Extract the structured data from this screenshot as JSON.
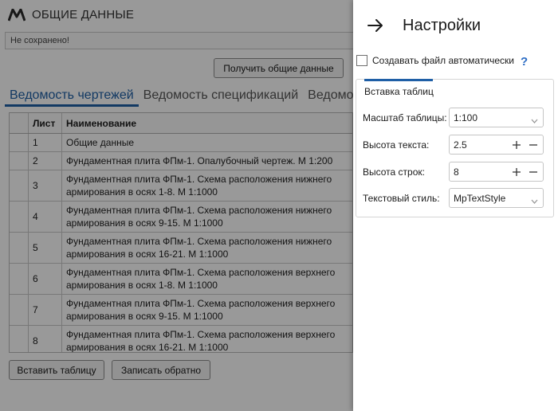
{
  "app": {
    "title": "ОБЩИЕ ДАННЫЕ",
    "status": "Не сохранено!",
    "get_button": "Получить общие данные",
    "tabs": [
      {
        "label": "Ведомость чертежей",
        "active": true
      },
      {
        "label": "Ведомость спецификаций",
        "active": false
      },
      {
        "label": "Ведомость",
        "active": false
      }
    ],
    "table": {
      "headers": [
        "Лист",
        "Наименование"
      ],
      "rows": [
        {
          "sheet": "1",
          "name": "Общие данные"
        },
        {
          "sheet": "2",
          "name": "Фундаментная плита ФПм-1. Опалубочный чертеж. М 1:200"
        },
        {
          "sheet": "3",
          "name": "Фундаментная плита ФПм-1. Схема расположения нижнего армирования в осях 1-8. М 1:1000"
        },
        {
          "sheet": "4",
          "name": "Фундаментная плита ФПм-1. Схема расположения нижнего армирования в осях 9-15. М 1:1000"
        },
        {
          "sheet": "5",
          "name": "Фундаментная плита ФПм-1. Схема расположения нижнего армирования в осях 16-21. М 1:1000"
        },
        {
          "sheet": "6",
          "name": "Фундаментная плита ФПм-1. Схема расположения верхнего армирования в осях 1-8. М 1:1000"
        },
        {
          "sheet": "7",
          "name": "Фундаментная плита ФПм-1. Схема расположения верхнего армирования в осях 9-15. М 1:1000"
        },
        {
          "sheet": "8",
          "name": "Фундаментная плита ФПм-1. Схема расположения верхнего армирования в осях 16-21. М 1:1000"
        }
      ]
    },
    "insert_button": "Вставить таблицу",
    "write_back_button": "Записать обратно"
  },
  "settings": {
    "title": "Настройки",
    "auto_file_label": "Создавать файл автоматически",
    "auto_file_checked": false,
    "help": "?",
    "group_title": "Вставка таблиц",
    "scale_label": "Масштаб таблицы:",
    "scale_value": "1:100",
    "text_height_label": "Высота текста:",
    "text_height_value": "2.5",
    "row_height_label": "Высота строк:",
    "row_height_value": "8",
    "text_style_label": "Текстовый стиль:",
    "text_style_value": "MpTextStyle"
  },
  "colors": {
    "accent": "#1f5fa6",
    "help": "#2b6cc4",
    "overlay": "rgba(0,0,0,0.40)"
  },
  "icons": [
    "app-logo-icon",
    "arrow-right-icon",
    "chevron-down-icon",
    "plus-icon",
    "minus-icon",
    "help-icon"
  ]
}
